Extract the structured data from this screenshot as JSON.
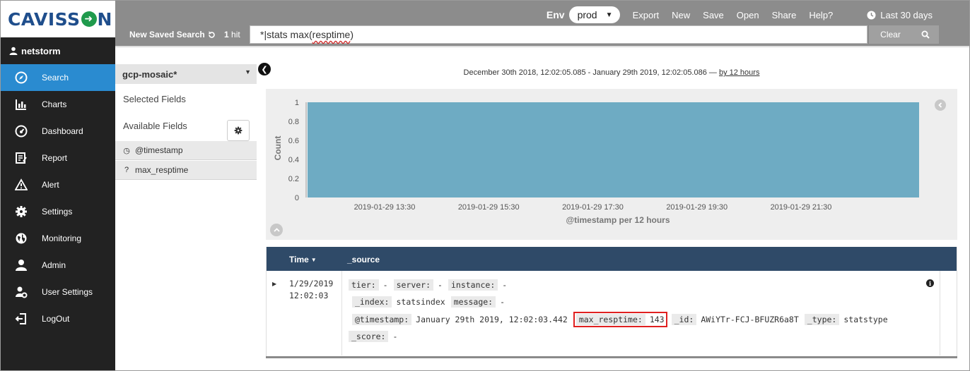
{
  "app": {
    "logo_text_left": "CAVISS",
    "logo_text_right": "N",
    "username": "netstorm"
  },
  "sidebar": {
    "items": [
      {
        "label": "Search",
        "icon": "compass-icon",
        "active": true
      },
      {
        "label": "Charts",
        "icon": "bar-chart-icon"
      },
      {
        "label": "Dashboard",
        "icon": "dashboard-icon"
      },
      {
        "label": "Report",
        "icon": "report-icon"
      },
      {
        "label": "Alert",
        "icon": "alert-icon"
      },
      {
        "label": "Settings",
        "icon": "gear-icon"
      },
      {
        "label": "Monitoring",
        "icon": "globe-icon"
      },
      {
        "label": "Admin",
        "icon": "admin-icon"
      },
      {
        "label": "User Settings",
        "icon": "user-settings-icon"
      },
      {
        "label": "LogOut",
        "icon": "logout-icon"
      }
    ]
  },
  "topbar": {
    "env_label": "Env",
    "env_value": "prod",
    "menu": [
      "Export",
      "New",
      "Save",
      "Open",
      "Share",
      "Help?"
    ],
    "timerange": "Last 30 days",
    "saved_search": "New Saved Search",
    "hits_count": "1",
    "hits_label": "hit",
    "query_prefix": "*|stats max(",
    "query_word": "resptime",
    "query_suffix": ")",
    "clear_label": "Clear"
  },
  "fields_panel": {
    "index_pattern": "gcp-mosaic*",
    "selected_fields_label": "Selected Fields",
    "available_fields_label": "Available Fields",
    "fields": [
      {
        "name": "@timestamp",
        "type_glyph": "◷"
      },
      {
        "name": "max_resptime",
        "type_glyph": "?"
      }
    ]
  },
  "histogram": {
    "date_range": "December 30th 2018, 12:02:05.085 - January 29th 2019, 12:02:05.086 —",
    "interval": "by 12 hours"
  },
  "chart_data": {
    "type": "bar",
    "ylabel": "Count",
    "xlabel": "@timestamp per 12 hours",
    "ylim": [
      0,
      1
    ],
    "yticks": [
      0,
      0.2,
      0.4,
      0.6,
      0.8,
      1
    ],
    "xticks": [
      "2019-01-29 13:30",
      "2019-01-29 15:30",
      "2019-01-29 17:30",
      "2019-01-29 19:30",
      "2019-01-29 21:30"
    ],
    "categories": [
      "2019-01-29 12:00"
    ],
    "values": [
      1
    ],
    "bar_color": "#6eabc3",
    "grid": false
  },
  "table": {
    "time_header": "Time",
    "source_header": "_source",
    "rows": [
      {
        "time_line1": "1/29/2019",
        "time_line2": "12:02:03",
        "source": {
          "tier_k": "tier:",
          "tier_v": "-",
          "server_k": "server:",
          "server_v": "-",
          "instance_k": "instance:",
          "instance_v": "-",
          "index_k": "_index:",
          "index_v": "statsindex",
          "message_k": "message:",
          "message_v": "-",
          "timestamp_k": "@timestamp:",
          "timestamp_v": "January 29th 2019, 12:02:03.442",
          "max_k": "max_resptime:",
          "max_v": "143",
          "id_k": "_id:",
          "id_v": "AWiYTr-FCJ-BFUZR6a8T",
          "type_k": "_type:",
          "type_v": "statstype",
          "score_k": "_score:",
          "score_v": "-"
        }
      }
    ]
  }
}
